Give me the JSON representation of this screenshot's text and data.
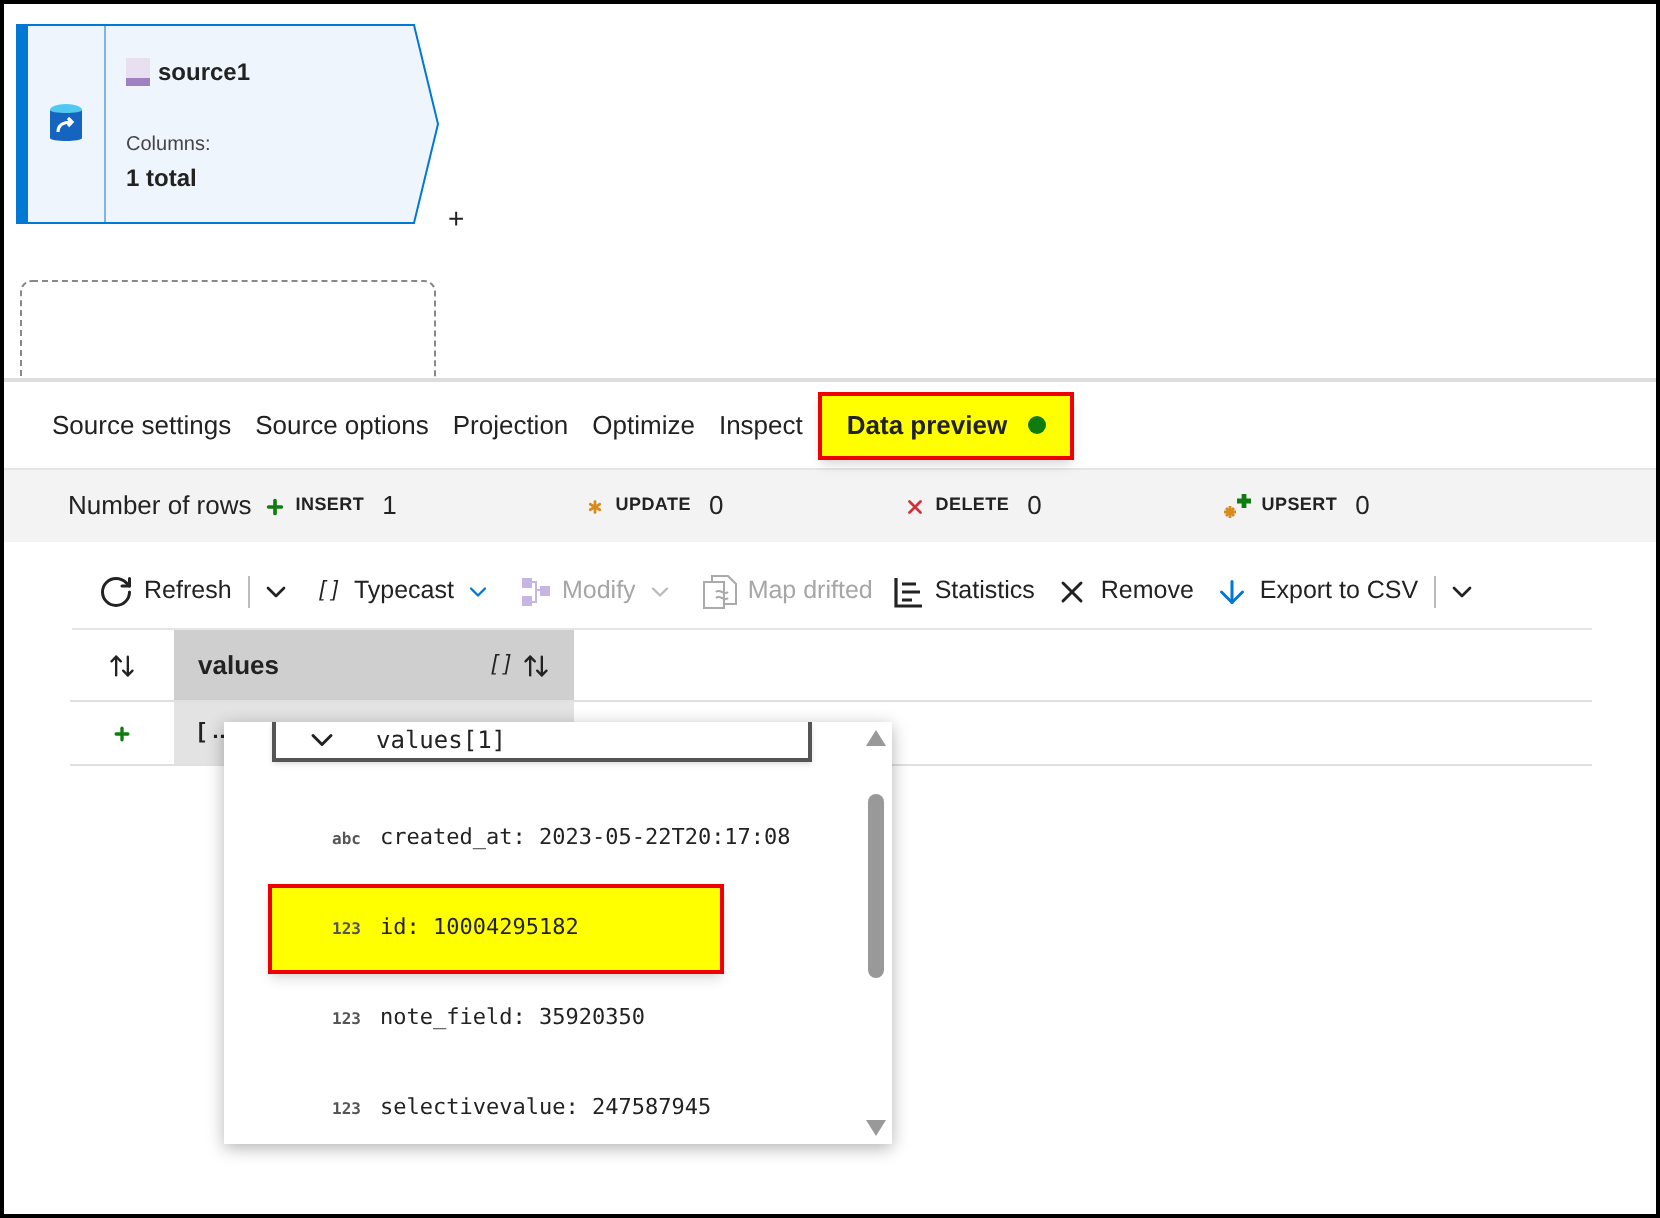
{
  "node": {
    "title": "source1",
    "columns_label": "Columns:",
    "columns_value": "1 total",
    "add": "+"
  },
  "tabs": [
    {
      "label": "Source settings",
      "selected": false
    },
    {
      "label": "Source options",
      "selected": false
    },
    {
      "label": "Projection",
      "selected": false
    },
    {
      "label": "Optimize",
      "selected": false
    },
    {
      "label": "Inspect",
      "selected": false
    },
    {
      "label": "Data preview",
      "selected": true,
      "color": "#107c10"
    }
  ],
  "row_counts": {
    "label": "Number of rows",
    "items": [
      {
        "kind": "insert",
        "label": "INSERT",
        "value": "1"
      },
      {
        "kind": "update",
        "label": "UPDATE",
        "value": "0"
      },
      {
        "kind": "delete",
        "label": "DELETE",
        "value": "0"
      },
      {
        "kind": "upsert",
        "label": "UPSERT",
        "value": "0"
      }
    ]
  },
  "toolbar": [
    {
      "kind": "refresh",
      "label": "Refresh",
      "disabled": false,
      "menu": true
    },
    {
      "kind": "typecast",
      "glyph": "[ ]",
      "label": "Typecast",
      "disabled": false,
      "menu": true
    },
    {
      "kind": "modify",
      "label": "Modify",
      "disabled": true,
      "menu": true
    },
    {
      "kind": "map",
      "label": "Map drifted",
      "disabled": true,
      "menu": false
    },
    {
      "kind": "statistics",
      "label": "Statistics",
      "disabled": false,
      "menu": false
    },
    {
      "kind": "remove",
      "label": "Remove",
      "disabled": false,
      "menu": false
    },
    {
      "kind": "export",
      "label": "Export to CSV",
      "disabled": false,
      "menu": true
    }
  ],
  "table": {
    "columns": [
      {
        "label": "values",
        "type_glyph": "[ ]"
      }
    ],
    "rows": [
      {
        "cell": "[ …"
      }
    ]
  },
  "popup": {
    "title": "values[1]",
    "fields": [
      {
        "type": "abc",
        "text": "created_at: 2023-05-22T20:17:08",
        "highlighted": false
      },
      {
        "type": "123",
        "text": "id: 10004295182",
        "highlighted": true
      },
      {
        "type": "123",
        "text": "note_field: 35920350",
        "highlighted": false
      },
      {
        "type": "123",
        "text": "selectivevalue: 247587945",
        "highlighted": false
      }
    ]
  }
}
